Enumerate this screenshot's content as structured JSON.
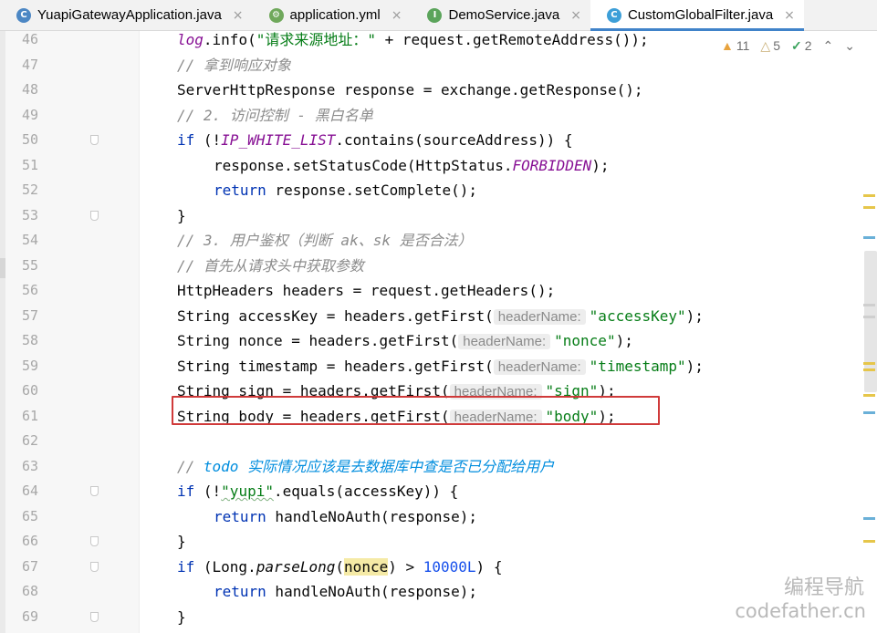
{
  "tabs": [
    {
      "label": "YuapiGatewayApplication.java",
      "icon": "spring-app-icon",
      "icon_color": "#4c87c4",
      "active": false
    },
    {
      "label": "application.yml",
      "icon": "yaml-spring-icon",
      "icon_color": "#6fa85b",
      "active": false
    },
    {
      "label": "DemoService.java",
      "icon": "interface-icon",
      "icon_color": "#5ba45b",
      "active": false
    },
    {
      "label": "CustomGlobalFilter.java",
      "icon": "class-icon",
      "icon_color": "#3d9fd8",
      "active": true
    }
  ],
  "tab_close_glyph": "×",
  "inspections": {
    "warnings": "11",
    "weak_warnings": "5",
    "typos": "2"
  },
  "lines": [
    {
      "n": "46",
      "tokens": [
        {
          "t": "log",
          "c": "const"
        },
        {
          "t": ".info(",
          "c": ""
        },
        {
          "t": "\"请求来源地址：\"",
          "c": "str"
        },
        {
          "t": " + request.getRemoteAddress());",
          "c": ""
        }
      ]
    },
    {
      "n": "47",
      "tokens": [
        {
          "t": "// 拿到响应对象",
          "c": "cmt"
        }
      ]
    },
    {
      "n": "48",
      "tokens": [
        {
          "t": "ServerHttpResponse response = exchange.getResponse();",
          "c": ""
        }
      ]
    },
    {
      "n": "49",
      "tokens": [
        {
          "t": "// 2. 访问控制 - 黑白名单",
          "c": "cmt"
        }
      ]
    },
    {
      "n": "50",
      "fold": true,
      "tokens": [
        {
          "t": "if",
          "c": "kw"
        },
        {
          "t": " (!",
          "c": ""
        },
        {
          "t": "IP_WHITE_LIST",
          "c": "const"
        },
        {
          "t": ".contains(sourceAddress)) {",
          "c": ""
        }
      ]
    },
    {
      "n": "51",
      "indent": 1,
      "tokens": [
        {
          "t": "response.setStatusCode(HttpStatus.",
          "c": ""
        },
        {
          "t": "FORBIDDEN",
          "c": "const"
        },
        {
          "t": ");",
          "c": ""
        }
      ]
    },
    {
      "n": "52",
      "indent": 1,
      "tokens": [
        {
          "t": "return",
          "c": "kw"
        },
        {
          "t": " response.setComplete();",
          "c": ""
        }
      ]
    },
    {
      "n": "53",
      "fold": true,
      "tokens": [
        {
          "t": "}",
          "c": ""
        }
      ]
    },
    {
      "n": "54",
      "tokens": [
        {
          "t": "// 3. 用户鉴权（判断 ak、sk 是否合法）",
          "c": "cmt"
        }
      ]
    },
    {
      "n": "55",
      "tokens": [
        {
          "t": "// 首先从请求头中获取参数",
          "c": "cmt"
        }
      ]
    },
    {
      "n": "56",
      "tokens": [
        {
          "t": "HttpHeaders headers = request.getHeaders();",
          "c": ""
        }
      ]
    },
    {
      "n": "57",
      "tokens": [
        {
          "t": "String accessKey = headers.getFirst(",
          "c": ""
        },
        {
          "t": "headerName:",
          "c": "hint"
        },
        {
          "t": "\"accessKey\"",
          "c": "str"
        },
        {
          "t": ");",
          "c": ""
        }
      ]
    },
    {
      "n": "58",
      "tokens": [
        {
          "t": "String nonce = headers.getFirst(",
          "c": ""
        },
        {
          "t": "headerName:",
          "c": "hint"
        },
        {
          "t": "\"nonce\"",
          "c": "str"
        },
        {
          "t": ");",
          "c": ""
        }
      ]
    },
    {
      "n": "59",
      "tokens": [
        {
          "t": "String timestamp = headers.getFirst(",
          "c": ""
        },
        {
          "t": "headerName:",
          "c": "hint"
        },
        {
          "t": "\"timestamp\"",
          "c": "str"
        },
        {
          "t": ");",
          "c": ""
        }
      ]
    },
    {
      "n": "60",
      "tokens": [
        {
          "t": "String sign = headers.getFirst(",
          "c": ""
        },
        {
          "t": "headerName:",
          "c": "hint"
        },
        {
          "t": "\"sign\"",
          "c": "str"
        },
        {
          "t": ");",
          "c": ""
        }
      ]
    },
    {
      "n": "61",
      "tokens": [
        {
          "t": "String body = headers.getFirst(",
          "c": ""
        },
        {
          "t": "headerName:",
          "c": "hint"
        },
        {
          "t": "\"body\"",
          "c": "str"
        },
        {
          "t": ");",
          "c": ""
        }
      ]
    },
    {
      "n": "62",
      "tokens": []
    },
    {
      "n": "63",
      "tokens": [
        {
          "t": "// ",
          "c": "cmt"
        },
        {
          "t": "todo",
          "c": "todo"
        },
        {
          "t": " 实际情况应该是去数据库中查是否已分配给用户",
          "c": "todo"
        }
      ]
    },
    {
      "n": "64",
      "fold": true,
      "tokens": [
        {
          "t": "if",
          "c": "kw"
        },
        {
          "t": " (!",
          "c": ""
        },
        {
          "t": "\"yupi\"",
          "c": "str wavy"
        },
        {
          "t": ".equals(accessKey)) {",
          "c": ""
        }
      ]
    },
    {
      "n": "65",
      "indent": 1,
      "tokens": [
        {
          "t": "return",
          "c": "kw"
        },
        {
          "t": " handleNoAuth(response);",
          "c": ""
        }
      ]
    },
    {
      "n": "66",
      "fold": true,
      "tokens": [
        {
          "t": "}",
          "c": ""
        }
      ]
    },
    {
      "n": "67",
      "fold": true,
      "tokens": [
        {
          "t": "if",
          "c": "kw"
        },
        {
          "t": " (Long.",
          "c": ""
        },
        {
          "t": "parseLong",
          "c": "ital"
        },
        {
          "t": "(",
          "c": ""
        },
        {
          "t": "nonce",
          "c": "hl"
        },
        {
          "t": ") > ",
          "c": ""
        },
        {
          "t": "10000L",
          "c": "num"
        },
        {
          "t": ") {",
          "c": ""
        }
      ]
    },
    {
      "n": "68",
      "indent": 1,
      "tokens": [
        {
          "t": "return",
          "c": "kw"
        },
        {
          "t": " handleNoAuth(response);",
          "c": ""
        }
      ]
    },
    {
      "n": "69",
      "fold": true,
      "tokens": [
        {
          "t": "}",
          "c": ""
        }
      ]
    }
  ],
  "watermark": {
    "line1": "编程导航",
    "line2": "codefather.cn"
  }
}
